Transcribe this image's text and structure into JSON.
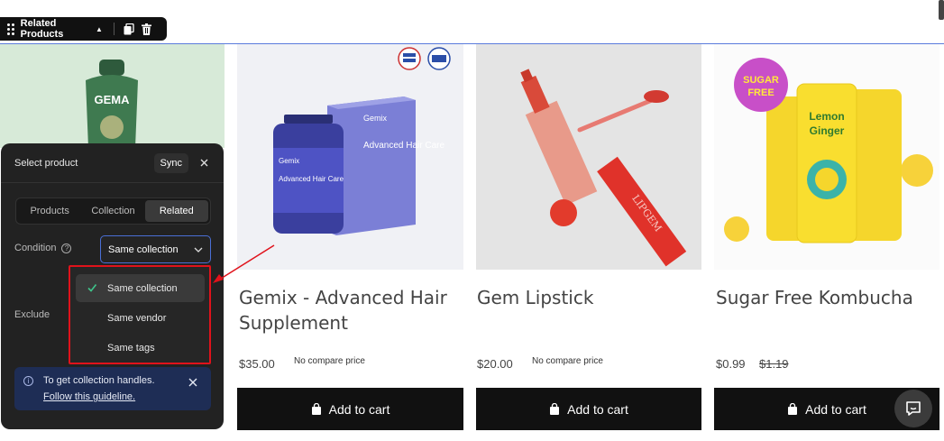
{
  "toolbar": {
    "title": "Related Products"
  },
  "products": [
    {
      "title_line1": "Gemix - Advanced Hair",
      "title_line2": "Supplement",
      "price": "$35.00",
      "compare": "No compare price",
      "cart_label": "Add to cart",
      "image_text": "Advanced Hair Care",
      "brand": "Gemix"
    },
    {
      "title": "Gem Lipstick",
      "price": "$20.00",
      "compare": "No compare price",
      "cart_label": "Add to cart",
      "image_text": "LIPGEM"
    },
    {
      "title": "Sugar Free Kombucha",
      "price": "$0.99",
      "compare": "$1.19",
      "cart_label": "Add to cart",
      "image_text_1": "Lemon",
      "image_text_2": "Ginger",
      "badge_1": "SUGAR",
      "badge_2": "FREE"
    }
  ],
  "first_image_text": "GEMA",
  "panel": {
    "title": "Select product",
    "sync_label": "Sync",
    "tabs": [
      "Products",
      "Collection",
      "Related"
    ],
    "active_tab": "Related",
    "condition_label": "Condition",
    "condition_value": "Same collection",
    "exclude_label": "Exclude",
    "options": [
      "Same collection",
      "Same vendor",
      "Same tags"
    ],
    "selected_option": "Same collection",
    "info_text": "To get collection handles.",
    "info_link": "Follow this guideline."
  },
  "colors": {
    "highlight_border": "#e0121b",
    "select_border": "#4a6fd6",
    "info_bg": "#1e2d55"
  }
}
